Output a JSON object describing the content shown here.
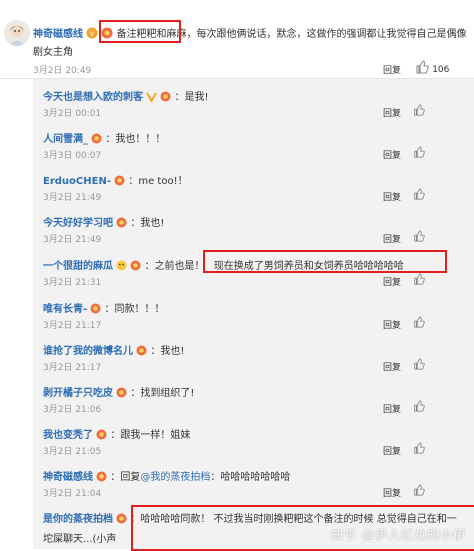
{
  "top": {
    "username": "神奇磁感线",
    "line1_a": "备注粑粑和麻麻",
    "line1_b": "，每次跟他俩说话，默念，这做作的强调都让我觉得自己是偶像",
    "line2": "剧女主角",
    "time": "3月2日 20:49",
    "reply_label": "回复",
    "like_count": "106"
  },
  "replies": [
    {
      "user": "今天也是想入欧的刺客",
      "text": "：是我!",
      "time": "3月2日 00:01"
    },
    {
      "user": "人间雪满_",
      "text": "：我也！！！",
      "time": "3月3日 00:07"
    },
    {
      "user": "ErduoCHEN-",
      "text": "：me too!！",
      "time": "3月2日 21:49"
    },
    {
      "user": "今天好好学习吧",
      "text": "：我也!",
      "time": "3月2日 21:49"
    },
    {
      "user": "一个很甜的麻瓜",
      "text_a": "：之前也是！",
      "text_b": "现在换成了男饲养员和女饲养员哈哈哈哈哈",
      "time": "3月2日 21:31"
    },
    {
      "user": "唯有长青-",
      "text": "：同款！！！",
      "time": "3月2日 21:17"
    },
    {
      "user": "谁抢了我的微博名儿",
      "text": "：我也!",
      "time": "3月2日 21:17"
    },
    {
      "user": "剥开橘子只吃皮",
      "text": "：找到组织了!",
      "time": "3月2日 21:06"
    },
    {
      "user": "我也变秃了",
      "text": "：跟我一样！姐妹",
      "time": "3月2日 21:05"
    },
    {
      "user": "神奇磁感线",
      "text_prefix": "：回复",
      "mention": "@我的蒸夜拍档",
      "text_a": "：",
      "text_b": "哈哈哈哈哈哈哈",
      "time": "3月2日 21:04"
    },
    {
      "user": "是你的蒸夜拍档",
      "text_a": "：",
      "text_b1": "哈哈哈哈同款！ 不过我当时刚换粑粑这个备注的时候 总觉得自己在和一",
      "text_b2": "坨屎聊天...(小声"
    }
  ],
  "reply_label": "回复",
  "watermark": "知乎 @伊人红妆的小伊",
  "colors": {
    "link": "#2e6eb5",
    "red_box": "#e02020",
    "reply_bg": "#f2f2f2"
  }
}
